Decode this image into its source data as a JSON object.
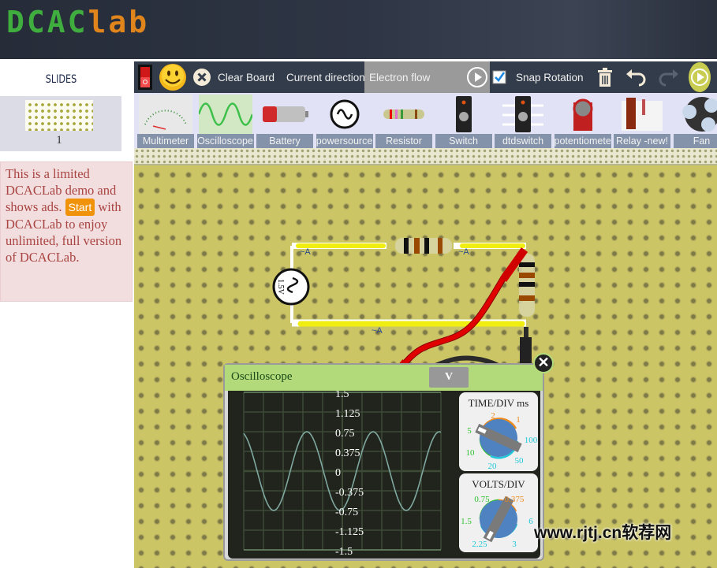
{
  "header": {
    "logo_left": "DCAC",
    "logo_right": "lab"
  },
  "sidebar": {
    "slides_title": "SLIDES",
    "slides": [
      {
        "number": "1"
      }
    ],
    "notice": {
      "text_before": "This is a limited DCACLab demo and shows ads.",
      "start_label": "Start",
      "text_after": "with DCACLab to enjoy unlimited, full version of DCACLab."
    }
  },
  "toolbar": {
    "clear_board": "Clear Board",
    "current_direction_label": "Current direction:",
    "current_direction_value": "Electron flow",
    "snap_rotation": "Snap Rotation",
    "snap_rotation_checked": true
  },
  "components": [
    {
      "label": "Multimeter",
      "icon": "multimeter-icon"
    },
    {
      "label": "Oscilloscope",
      "icon": "oscilloscope-icon"
    },
    {
      "label": "Battery",
      "icon": "battery-icon"
    },
    {
      "label": "powersource",
      "icon": "ac-source-icon"
    },
    {
      "label": "Resistor",
      "icon": "resistor-icon"
    },
    {
      "label": "Switch",
      "icon": "switch-icon"
    },
    {
      "label": "dtdswitch",
      "icon": "dtd-switch-icon"
    },
    {
      "label": "potentiometer",
      "icon": "potentiometer-icon"
    },
    {
      "label": "Relay -new!",
      "icon": "relay-icon"
    },
    {
      "label": "Fan",
      "icon": "fan-icon"
    }
  ],
  "circuit": {
    "source_label": "1.5V",
    "ammeter_labels": [
      "~A",
      "~A",
      "~A"
    ]
  },
  "oscilloscope": {
    "title": "Oscilloscope",
    "channel_button": "V",
    "y_ticks": [
      "1.5",
      "1.125",
      "0.75",
      "0.375",
      "0",
      "-0.375",
      "-0.75",
      "-1.125",
      "-1.5"
    ],
    "waveform": {
      "amplitude": 0.75,
      "period_divs": 3.36
    },
    "time_div": {
      "title": "TIME/DIV ms",
      "options": [
        "2",
        "1",
        "5",
        "100",
        "10",
        "50",
        "20"
      ]
    },
    "volts_div": {
      "title": "VOLTS/DIV",
      "options": [
        "0.75",
        "0.375",
        "1.5",
        "6",
        "2.25",
        "3"
      ]
    },
    "colors": {
      "trace": "#7fa8a0",
      "grid": "#3d4a36",
      "knob": "#4f82c0"
    }
  },
  "watermark": "www.rjtj.cn软荐网"
}
